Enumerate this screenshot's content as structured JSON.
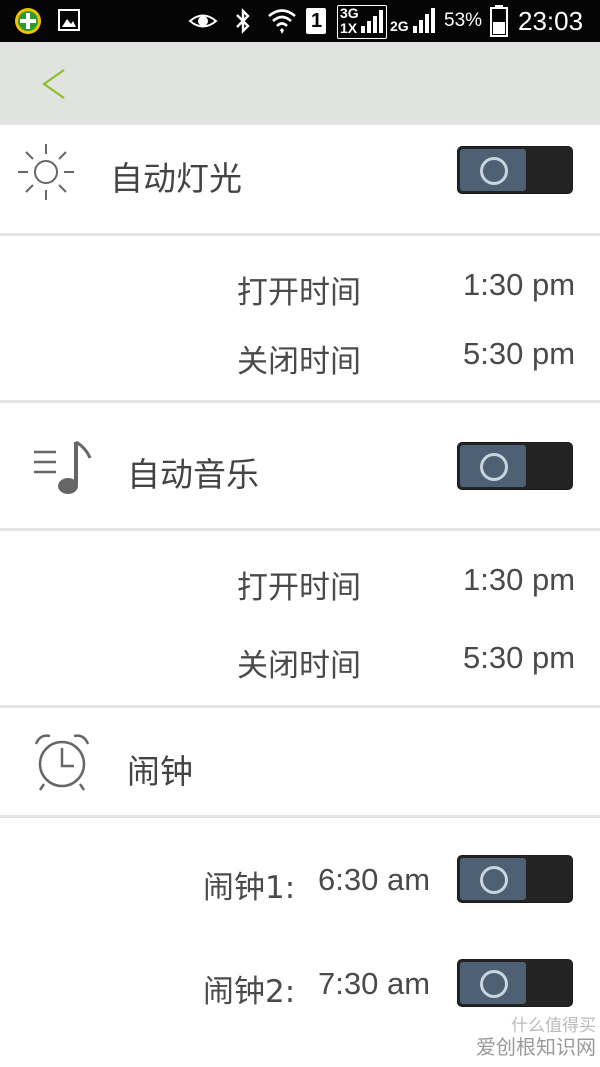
{
  "status_bar": {
    "sim_indicator": "1",
    "network_3g": "3G",
    "network_1x": "1X",
    "network_2g": "2G",
    "battery": "53%",
    "time": "23:03"
  },
  "header": {
    "back_label": "<"
  },
  "sections": {
    "auto_light": {
      "label": "自动灯光",
      "toggle_on": false,
      "open_label": "打开时间",
      "open_time": "1:30 pm",
      "close_label": "关闭时间",
      "close_time": "5:30 pm"
    },
    "auto_music": {
      "label": "自动音乐",
      "toggle_on": false,
      "open_label": "打开时间",
      "open_time": "1:30 pm",
      "close_label": "关闭时间",
      "close_time": "5:30 pm"
    },
    "alarm": {
      "label": "闹钟",
      "alarm1_label": "闹钟1:",
      "alarm1_time": "6:30 am",
      "alarm1_on": false,
      "alarm2_label": "闹钟2:",
      "alarm2_time": "7:30 am",
      "alarm2_on": false
    }
  },
  "watermark": {
    "line1": "什么值得买",
    "line2": "爱创根知识网"
  },
  "colors": {
    "header_bg": "#e1e3e1",
    "back_arrow": "#8cbf26",
    "toggle_knob": "#4e6174",
    "toggle_track": "#232323"
  }
}
